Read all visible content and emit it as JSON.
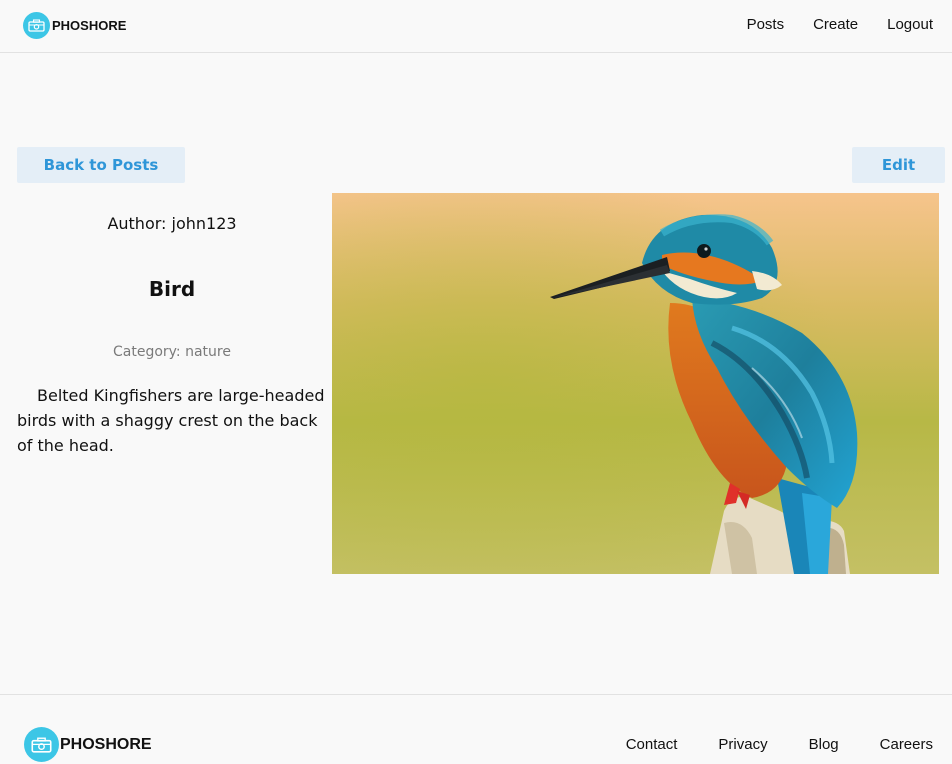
{
  "header": {
    "brand": "PHOSHORE",
    "nav": [
      "Posts",
      "Create",
      "Logout"
    ]
  },
  "actions": {
    "back_label": "Back to Posts",
    "edit_label": "Edit"
  },
  "post": {
    "author": "Author: john123",
    "title": "Bird",
    "category": "Category: nature",
    "description": "Belted Kingfishers are large-headed birds with a shaggy crest on the back of the head."
  },
  "footer": {
    "brand": "PHOSHORE",
    "links": [
      "Contact",
      "Privacy",
      "Blog",
      "Careers"
    ]
  },
  "colors": {
    "accent": "#3cc6e6",
    "button_bg": "#e4eef7",
    "button_text": "#2f96d8"
  },
  "icons": {
    "logo": "camera-icon"
  }
}
